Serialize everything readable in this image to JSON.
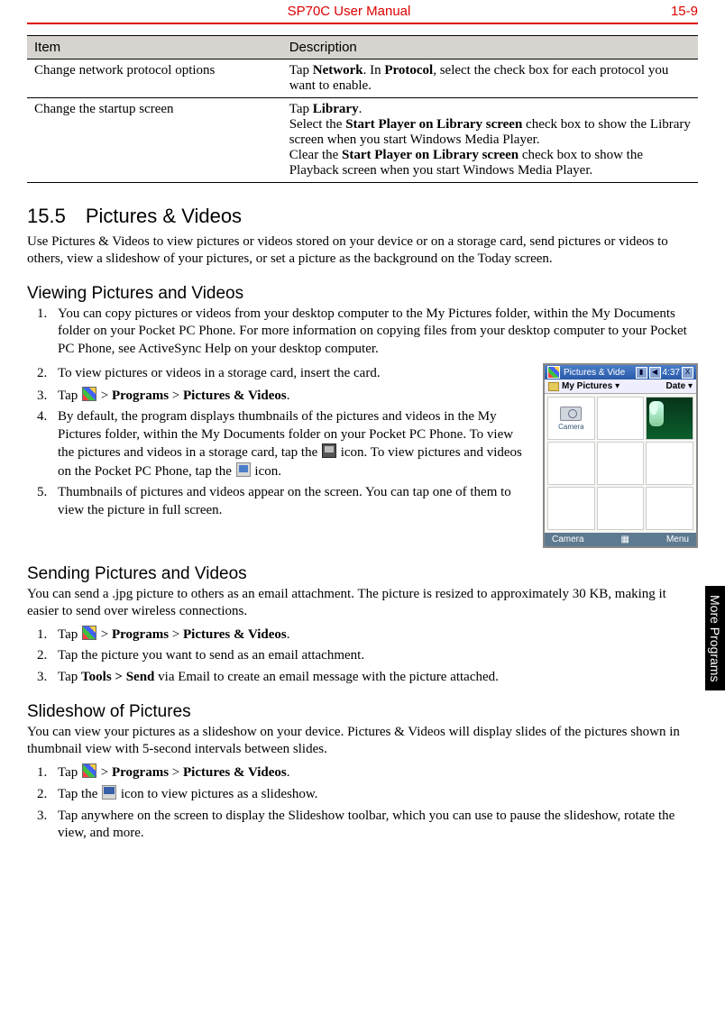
{
  "header": {
    "title": "SP70C User Manual",
    "page": "15-9"
  },
  "side_tab": "More Programs",
  "table": {
    "head_item": "Item",
    "head_desc": "Description",
    "rows": [
      {
        "item": "Change network protocol options",
        "desc_parts": {
          "a": "Tap ",
          "b": "Network",
          "c": ". In ",
          "d": "Protocol",
          "e": ", select the check box for each protocol you want to enable."
        }
      },
      {
        "item": "Change the startup screen",
        "desc_parts": {
          "a": "Tap ",
          "b": "Library",
          "c": ".",
          "d": "Select the ",
          "e": "Start Player on Library screen",
          "f": " check box to show the Library screen when you start Windows Media Player.",
          "g": "Clear the ",
          "h": "Start Player on Library screen",
          "i": " check box to show the Playback screen when you start Windows Media Player."
        }
      }
    ]
  },
  "sec155": {
    "heading": "15.5 Pictures & Videos",
    "intro": "Use Pictures & Videos to view pictures or videos stored on your device or on a storage card, send pictures or videos to others, view a slideshow of your pictures, or set a picture as the background on the Today screen."
  },
  "viewing": {
    "heading": "Viewing Pictures and Videos",
    "step1": "You can copy pictures or videos from your desktop computer to the My Pictures folder, within the My Documents folder on your Pocket PC Phone. For more information on copying files from your desktop computer to your Pocket PC Phone, see ActiveSync Help on your desktop computer.",
    "step2": "To view pictures or videos in a storage card, insert the card.",
    "step3": {
      "a": "Tap ",
      "b": " > ",
      "c": "Programs",
      "d": " > ",
      "e": "Pictures & Videos",
      "f": "."
    },
    "step4": {
      "a": "By default, the program displays thumbnails of the pictures and videos in the My Pictures folder, within the My Documents folder on your Pocket PC Phone. To view the pictures and videos in a storage card, tap the ",
      "b": " icon. To view pictures and videos on the Pocket PC Phone, tap the ",
      "c": " icon."
    },
    "step5": "Thumbnails of pictures and videos appear on the screen. You can tap one of them to view the picture in full screen."
  },
  "screenshot": {
    "titlebar": "Pictures & Vide",
    "time": "4:37",
    "close": "X",
    "sig": "▮",
    "spk": "◀",
    "folder_label": "My Pictures",
    "folder_arrow": "▾",
    "sort_label": "Date",
    "sort_arrow": "▾",
    "camera_label": "Camera",
    "bottom_left": "Camera",
    "bottom_mid": "▦",
    "bottom_right": "Menu"
  },
  "sending": {
    "heading": "Sending Pictures and Videos",
    "intro": "You can send a .jpg picture to others as an email attachment. The picture is resized to approximately 30 KB, making it easier to send over wireless connections.",
    "step1": {
      "a": "Tap ",
      "b": " > ",
      "c": "Programs",
      "d": " > ",
      "e": "Pictures & Videos",
      "f": "."
    },
    "step2": "Tap the picture you want to send as an email attachment.",
    "step3": {
      "a": "Tap ",
      "b": "Tools > Send",
      "c": " via Email to create an email message with the picture attached."
    }
  },
  "slideshow": {
    "heading": "Slideshow of Pictures",
    "intro": "You can view your pictures as a slideshow on your device. Pictures & Videos will display slides of the pictures shown in thumbnail view with 5-second intervals between slides.",
    "step1": {
      "a": "Tap ",
      "b": " > ",
      "c": "Programs",
      "d": " > ",
      "e": "Pictures & Videos",
      "f": "."
    },
    "step2": {
      "a": "Tap the ",
      "b": " icon to view pictures as a slideshow."
    },
    "step3": "Tap anywhere on the screen to display the Slideshow toolbar, which you can use to pause the slideshow, rotate the view, and more."
  }
}
